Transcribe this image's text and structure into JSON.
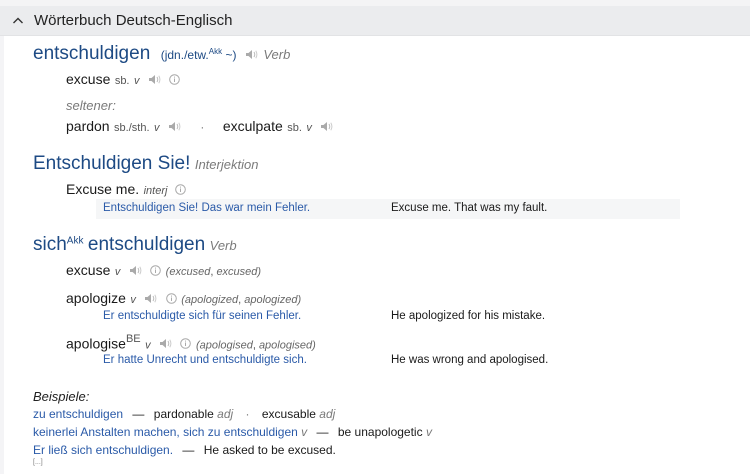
{
  "header": {
    "title": "Wörterbuch Deutsch-Englisch"
  },
  "entry1": {
    "headword": "entschuldigen",
    "valency_pre": "(jdn./etw.",
    "valency_sup": "Akk",
    "valency_post": "~)",
    "pos": "Verb",
    "t1": {
      "word": "excuse",
      "gram": "sb.",
      "pos": "v"
    },
    "rarer_label": "seltener:",
    "t2": {
      "word": "pardon",
      "gram": "sb./sth.",
      "pos": "v"
    },
    "sep": "·",
    "t3": {
      "word": "exculpate",
      "gram": "sb.",
      "pos": "v"
    }
  },
  "entry2": {
    "headword": "Entschuldigen Sie!",
    "pos": "Interjektion",
    "t1": {
      "word": "Excuse me.",
      "pos": "interj"
    },
    "example": {
      "de": "Entschuldigen Sie! Das war mein Fehler.",
      "en": "Excuse me. That was my fault."
    }
  },
  "entry3": {
    "headword_pre": "sich",
    "headword_sup": "Akk",
    "headword_post": "entschuldigen",
    "pos": "Verb",
    "t1": {
      "word": "excuse",
      "pos": "v",
      "forms_a": "(excused",
      "sep": ", ",
      "forms_b": "excused)"
    },
    "t2": {
      "word": "apologize",
      "pos": "v",
      "forms_a": "(apologized",
      "sep": ", ",
      "forms_b": "apologized)",
      "example": {
        "de": "Er entschuldigte sich für seinen Fehler.",
        "en": "He apologized for his mistake."
      }
    },
    "t3": {
      "word": "apologise",
      "sup": "BE",
      "pos": "v",
      "forms_a": "(apologised",
      "sep": ", ",
      "forms_b": "apologised)",
      "example": {
        "de": "Er hatte Unrecht und entschuldigte sich.",
        "en": "He was wrong and apologised."
      }
    }
  },
  "examples": {
    "label": "Beispiele:",
    "row1": {
      "de": "zu entschuldigen",
      "dash": "—",
      "en1": "pardonable",
      "pos1": "adj",
      "sep": "·",
      "en2": "excusable",
      "pos2": "adj"
    },
    "row2": {
      "de": "keinerlei Anstalten machen, sich zu entschuldigen",
      "pos_de": "v",
      "dash": "—",
      "en": "be unapologetic",
      "pos_en": "v"
    },
    "row3": {
      "de": "Er ließ sich entschuldigen.",
      "dash": "—",
      "en": "He asked to be excused."
    },
    "more": "[...]"
  }
}
